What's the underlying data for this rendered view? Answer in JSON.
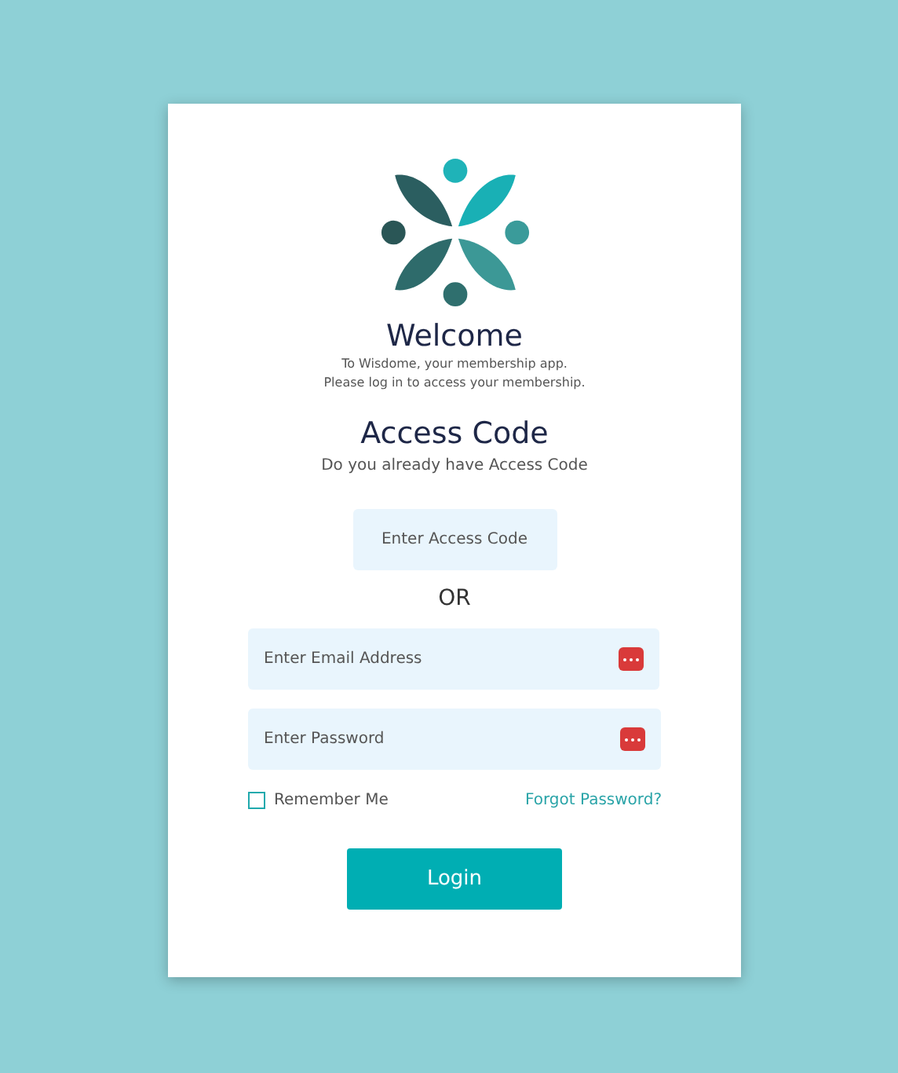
{
  "welcome": {
    "title": "Welcome",
    "lines": [
      "To Wisdome, your membership app.",
      "Please log in to access your membership."
    ]
  },
  "access": {
    "title": "Access Code",
    "subtitle": "Do you already have Access Code",
    "placeholder": "Enter Access Code"
  },
  "separator": "OR",
  "email": {
    "placeholder": "Enter Email Address"
  },
  "password": {
    "placeholder": "Enter Password"
  },
  "remember": {
    "label": "Remember Me",
    "checked": false
  },
  "forgot": "Forgot Password?",
  "login": "Login"
}
